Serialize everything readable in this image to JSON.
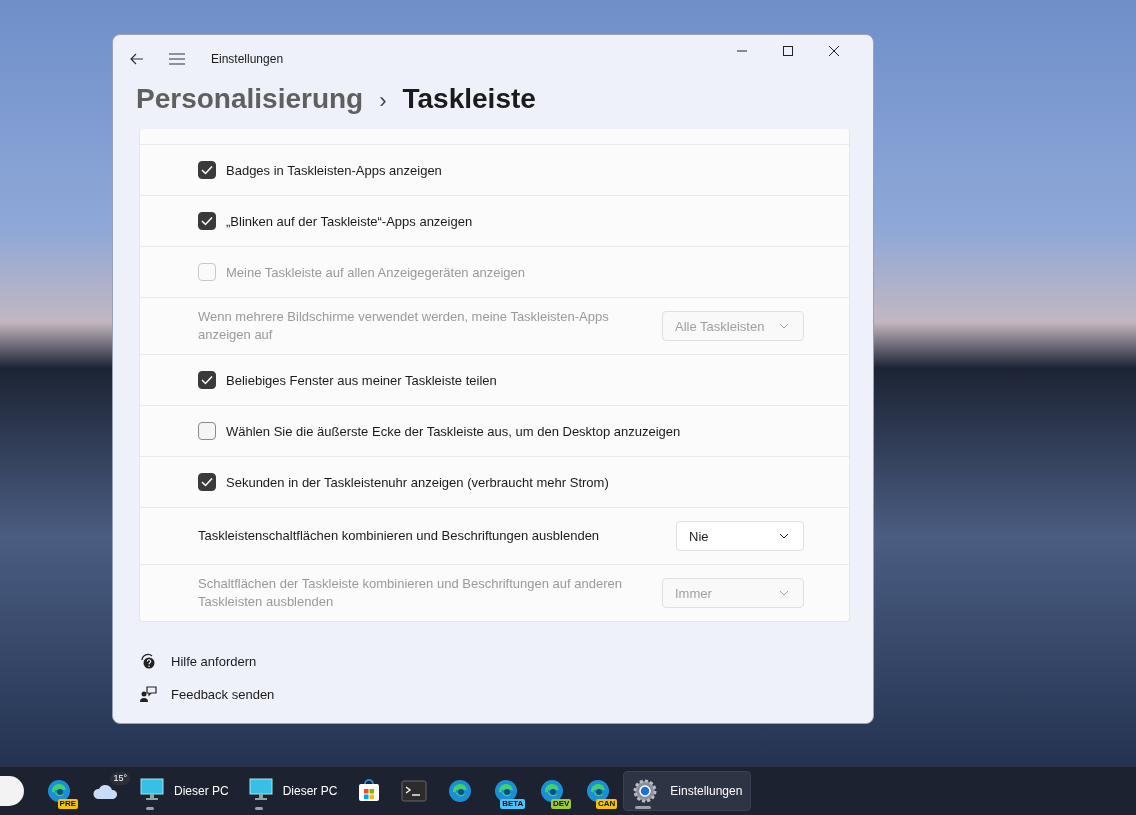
{
  "window": {
    "title": "Einstellungen"
  },
  "breadcrumb": {
    "parent": "Personalisierung",
    "separator": "›",
    "current": "Taskleiste"
  },
  "rows": [
    {
      "kind": "checkbox",
      "label": "Badges in Taskleisten-Apps anzeigen",
      "checked": true,
      "disabled": false
    },
    {
      "kind": "checkbox",
      "label": "„Blinken auf der Taskleiste“-Apps anzeigen",
      "checked": true,
      "disabled": false
    },
    {
      "kind": "checkbox",
      "label": "Meine Taskleiste auf allen Anzeigegeräten anzeigen",
      "checked": false,
      "disabled": true
    },
    {
      "kind": "dropdown",
      "label": "Wenn mehrere Bildschirme verwendet werden, meine Taskleisten-Apps anzeigen auf",
      "value": "Alle Taskleisten",
      "disabled": true
    },
    {
      "kind": "checkbox",
      "label": "Beliebiges Fenster aus meiner Taskleiste teilen",
      "checked": true,
      "disabled": false
    },
    {
      "kind": "checkbox",
      "label": "Wählen Sie die äußerste Ecke der Taskleiste aus, um den Desktop anzuzeigen",
      "checked": false,
      "disabled": false
    },
    {
      "kind": "checkbox",
      "label": "Sekunden in der Taskleistenuhr anzeigen (verbraucht mehr Strom)",
      "checked": true,
      "disabled": false
    },
    {
      "kind": "dropdown",
      "label": "Taskleistenschaltflächen kombinieren und Beschriftungen ausblenden",
      "value": "Nie",
      "disabled": false
    },
    {
      "kind": "dropdown",
      "label": "Schaltflächen der Taskleiste kombinieren und Beschriftungen auf anderen Taskleisten ausblenden",
      "value": "Immer",
      "disabled": true
    }
  ],
  "links": [
    {
      "kind": "help",
      "label": "Hilfe anfordern"
    },
    {
      "kind": "feedback",
      "label": "Feedback senden"
    }
  ],
  "taskbar": [
    {
      "kind": "edge",
      "badge": "PRE",
      "color": "#f5c400",
      "running": false,
      "selected": false
    },
    {
      "kind": "weather",
      "badge": "15°",
      "running": false,
      "selected": false
    },
    {
      "kind": "pc",
      "label": "Dieser PC",
      "running": true,
      "selected": false
    },
    {
      "kind": "pc",
      "label": "Dieser PC",
      "running": true,
      "selected": false
    },
    {
      "kind": "store",
      "running": false,
      "selected": false
    },
    {
      "kind": "terminal",
      "running": false,
      "selected": false
    },
    {
      "kind": "edge",
      "running": false,
      "selected": false
    },
    {
      "kind": "edge",
      "badge": "BETA",
      "color": "#4fc3f7",
      "running": false,
      "selected": false
    },
    {
      "kind": "edge",
      "badge": "DEV",
      "color": "#9ccc3c",
      "running": false,
      "selected": false
    },
    {
      "kind": "edge",
      "badge": "CAN",
      "color": "#f5c400",
      "running": false,
      "selected": false
    },
    {
      "kind": "gear",
      "label": "Einstellungen",
      "running": true,
      "selected": true
    }
  ]
}
